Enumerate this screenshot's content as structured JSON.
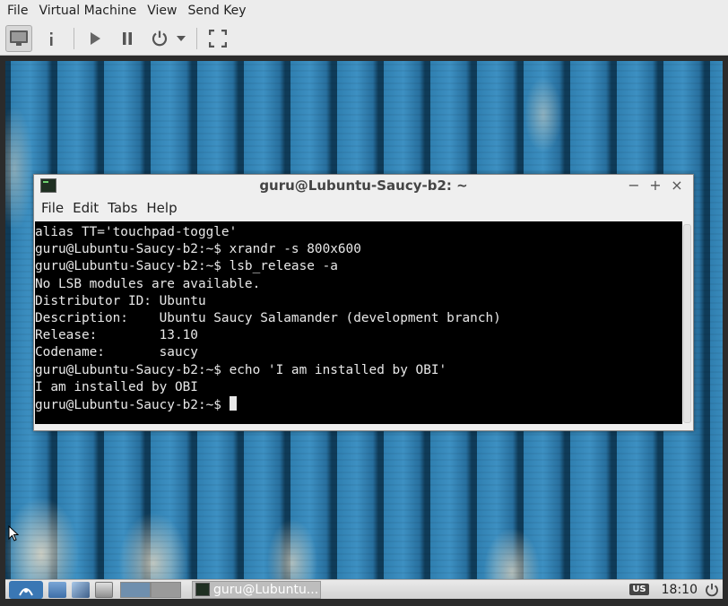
{
  "host": {
    "menu": [
      "File",
      "Virtual Machine",
      "View",
      "Send Key"
    ],
    "toolbar": {
      "console_icon": "monitor-icon",
      "info_icon": "info-icon",
      "run_icon": "play-icon",
      "pause_icon": "pause-icon",
      "power_icon": "power-icon",
      "power_menu_icon": "chevron-down-icon",
      "fullscreen_icon": "fullscreen-icon"
    }
  },
  "terminal": {
    "title": "guru@Lubuntu-Saucy-b2: ~",
    "controls": {
      "minimize": "−",
      "maximize": "+",
      "close": "×"
    },
    "menu": [
      "File",
      "Edit",
      "Tabs",
      "Help"
    ],
    "lines": [
      "alias TT='touchpad-toggle'",
      "guru@Lubuntu-Saucy-b2:~$ xrandr -s 800x600",
      "guru@Lubuntu-Saucy-b2:~$ lsb_release -a",
      "No LSB modules are available.",
      "Distributor ID: Ubuntu",
      "Description:    Ubuntu Saucy Salamander (development branch)",
      "Release:        13.10",
      "Codename:       saucy",
      "guru@Lubuntu-Saucy-b2:~$ echo 'I am installed by OBI'",
      "I am installed by OBI"
    ],
    "prompt": "guru@Lubuntu-Saucy-b2:~$ "
  },
  "taskbar": {
    "task_label": "guru@Lubuntu...",
    "keyboard_layout": "US",
    "clock": "18:10"
  },
  "colors": {
    "terminal_bg": "#000000",
    "terminal_fg": "#e8e8e8",
    "taskbar_bg": "#d8d8d8",
    "wallpaper_accent": "#2f7fb0"
  }
}
